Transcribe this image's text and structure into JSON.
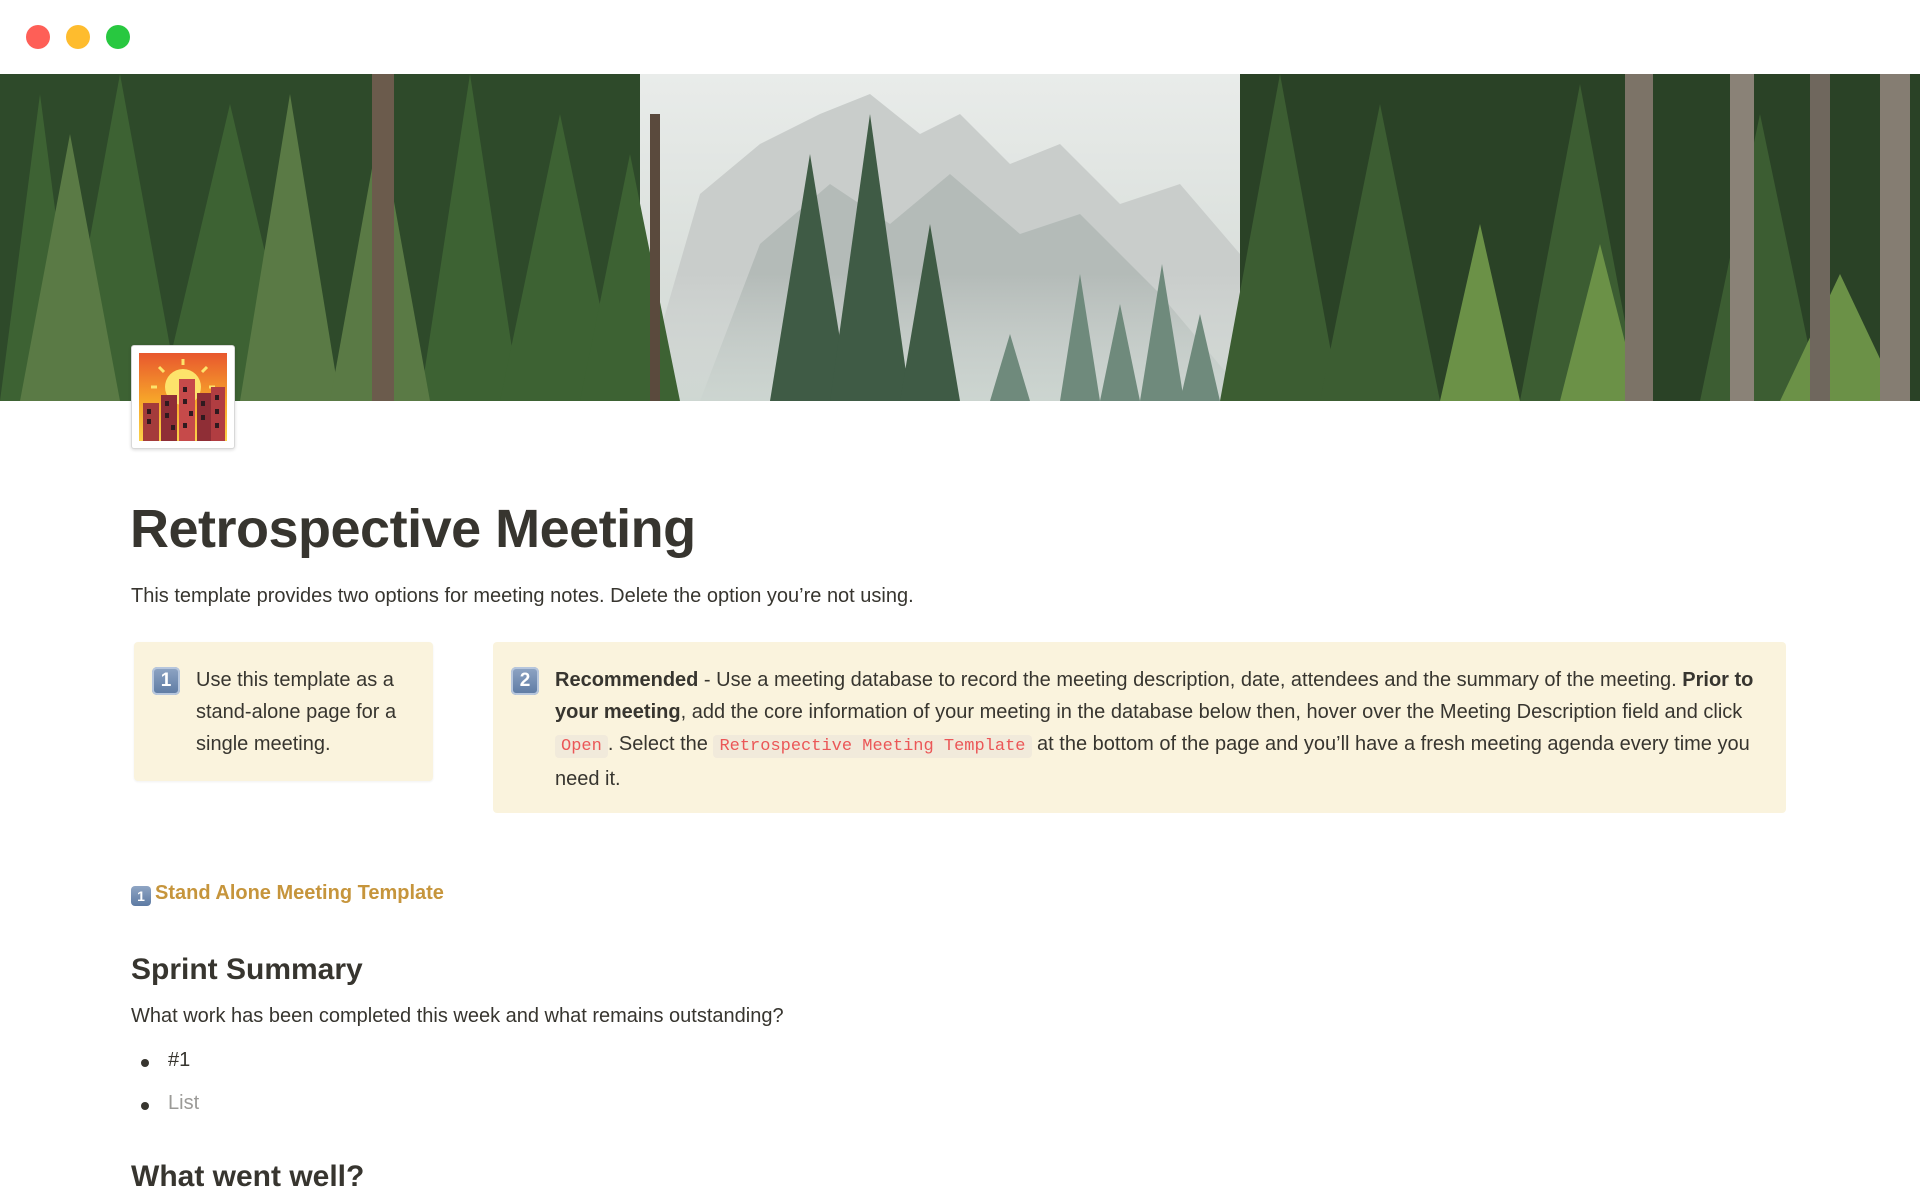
{
  "window": {
    "controls": [
      "close",
      "minimize",
      "zoom"
    ]
  },
  "cover": {
    "description": "forest-mountain-cover-image"
  },
  "page": {
    "icon": "sunset-city-icon",
    "title": "Retrospective Meeting",
    "intro": "This template provides two options for meeting notes. Delete the option you’re not using."
  },
  "callout_one": {
    "key": "1",
    "text": "Use this template as a stand-alone page for a single meeting."
  },
  "callout_two": {
    "key": "2",
    "bold_1": "Recommended",
    "text_1": " - Use a meeting database to record the meeting description, date, attendees and the summary of the meeting. ",
    "bold_2": "Prior to your meeting",
    "text_2": ", add the core information of your meeting in the database below then, hover over the Meeting Description field and click ",
    "code_1": "Open",
    "text_3": ". Select the ",
    "code_2": "Retrospective Meeting Template",
    "text_4": " at the bottom of the page and you’ll have a fresh meeting agenda every time you need it."
  },
  "template_link": {
    "key": "1",
    "label": "Stand Alone Meeting Template",
    "color": "#c6953c"
  },
  "sprint_summary": {
    "heading": "Sprint Summary",
    "question": "What work has been completed this week and what remains outstanding?",
    "items": [
      "#1",
      "List"
    ]
  },
  "went_well": {
    "heading": "What went well?"
  }
}
